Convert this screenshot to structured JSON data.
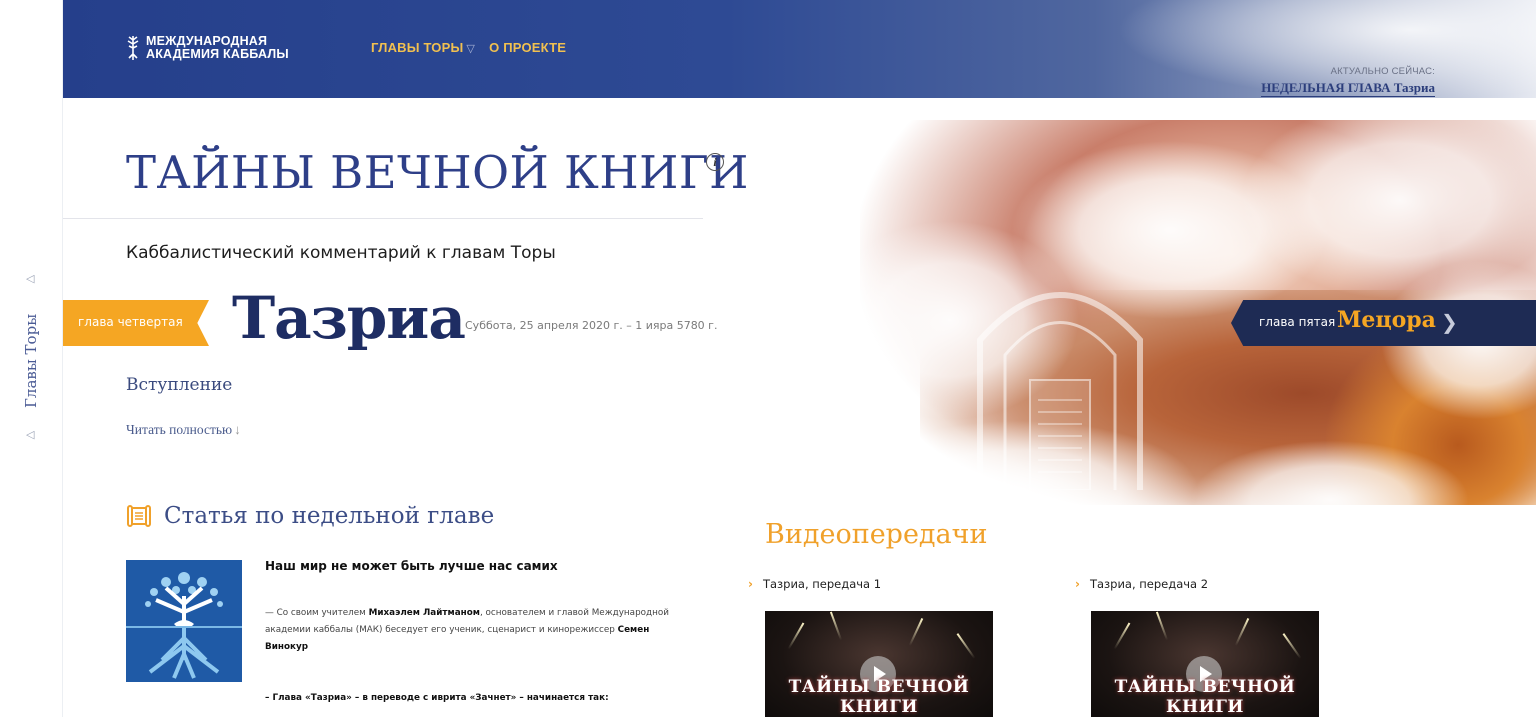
{
  "siderail": {
    "label": "Главы Торы"
  },
  "header": {
    "logo_line1": "МЕЖДУНАРОДНАЯ",
    "logo_line2": "АКАДЕМИЯ КАББАЛЫ",
    "nav": [
      {
        "label": "ГЛАВЫ ТОРЫ",
        "has_dropdown": true
      },
      {
        "label": "О ПРОЕКТЕ",
        "has_dropdown": false
      }
    ],
    "current_caption": "АКТУАЛЬНО СЕЙЧАС:",
    "current_link": "НЕДЕЛЬНАЯ ГЛАВА Тазриа"
  },
  "page": {
    "title": "ТАЙНЫ ВЕЧНОЙ КНИГИ",
    "info_icon": "i",
    "subtitle": "Каббалистический комментарий к главам Торы",
    "prev_label": "глава четвертая",
    "chapter_name": "Тазриа",
    "chapter_date": "Суббота, 25 апреля 2020 г. – 1 ияра 5780 г.",
    "intro": "Вступление",
    "read_more": "Читать полностью",
    "next_label": "глава пятая",
    "next_name": "Мецора"
  },
  "article": {
    "heading": "Статья по недельной главе",
    "title": "Наш мир не может быть лучше нас самих",
    "lead_prefix": "— Со своим учителем ",
    "lead_name1": "Михаэлем Лайтманом",
    "lead_mid": ", основателем и главой Международной академии каббалы (МАК) беседует его ученик, сценарист и кинорежиссер ",
    "lead_name2": "Семен Винокур",
    "quote": "– Глава «Тазриа» – в переводе с иврита «Зачнет» – начинается так:"
  },
  "videos": {
    "heading": "Видеопередачи",
    "items": [
      {
        "title": "Тазриа, передача 1",
        "caption": "ТАЙНЫ ВЕЧНОЙ КНИГИ"
      },
      {
        "title": "Тазриа, передача 2",
        "caption": "ТАЙНЫ ВЕЧНОЙ КНИГИ"
      }
    ]
  },
  "colors": {
    "header_blue": "#2e4a94",
    "accent_orange": "#f5a623",
    "navy_badge": "#1e2b54",
    "title_blue": "#2e3f88"
  }
}
